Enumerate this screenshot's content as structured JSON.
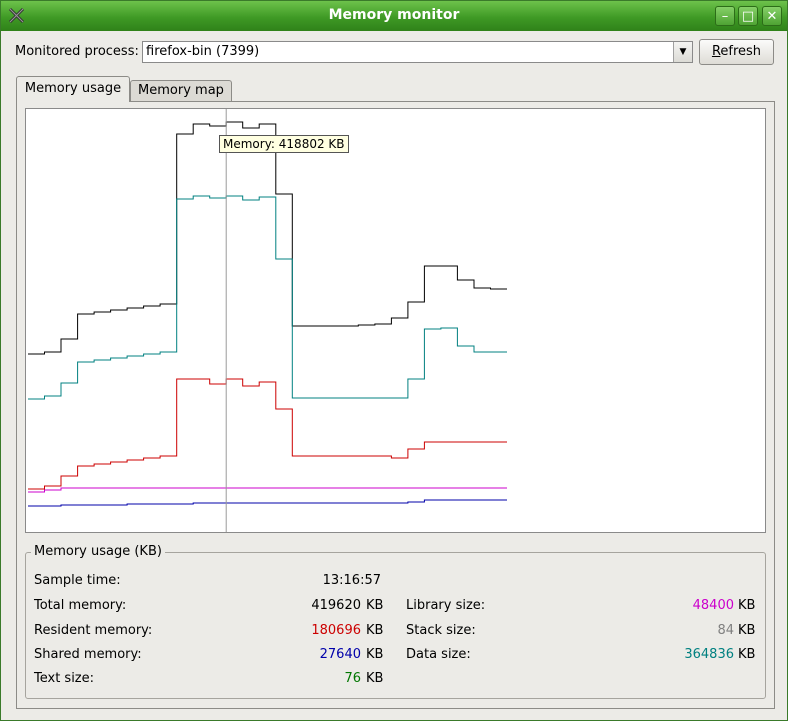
{
  "window": {
    "title": "Memory monitor"
  },
  "toolbar": {
    "process_label": "Monitored process:",
    "process_value": "firefox-bin (7399)",
    "refresh_prefix": "R",
    "refresh_rest": "efresh"
  },
  "tabs": [
    {
      "label": "Memory usage",
      "active": true
    },
    {
      "label": "Memory map",
      "active": false
    }
  ],
  "tooltip": {
    "text": "Memory: 418802 KB"
  },
  "colors": {
    "total": "#000000",
    "resident": "#cc0000",
    "shared": "#0000aa",
    "text": "#007700",
    "library": "#cc00cc",
    "stack": "#808080",
    "data": "#008080"
  },
  "chart_data": {
    "type": "line",
    "series": [
      {
        "key": "total",
        "values": [
          170,
          172,
          185,
          210,
          212,
          214,
          216,
          218,
          220,
          390,
          400,
          398,
          402,
          396,
          400,
          330,
          198,
          198,
          198,
          198,
          199,
          200,
          206,
          222,
          258,
          258,
          244,
          236,
          235,
          235
        ]
      },
      {
        "key": "data",
        "values": [
          125,
          128,
          141,
          162,
          164,
          166,
          168,
          170,
          172,
          325,
          328,
          326,
          328,
          324,
          327,
          265,
          126,
          126,
          126,
          126,
          126,
          126,
          126,
          145,
          195,
          196,
          178,
          172,
          172,
          172
        ]
      },
      {
        "key": "resident",
        "values": [
          35,
          38,
          48,
          58,
          60,
          62,
          64,
          66,
          68,
          145,
          145,
          140,
          145,
          138,
          142,
          115,
          68,
          68,
          68,
          68,
          68,
          68,
          66,
          75,
          82,
          82,
          82,
          82,
          82,
          82
        ]
      },
      {
        "key": "library",
        "values": [
          32,
          34,
          36,
          36,
          36,
          36,
          36,
          36,
          36,
          36,
          36,
          36,
          36,
          36,
          36,
          36,
          36,
          36,
          36,
          36,
          36,
          36,
          36,
          36,
          36,
          36,
          36,
          36,
          36,
          36
        ]
      },
      {
        "key": "shared",
        "values": [
          18,
          18,
          19,
          19,
          19,
          19,
          20,
          20,
          20,
          20,
          21,
          21,
          21,
          21,
          21,
          21,
          21,
          21,
          21,
          21,
          21,
          21,
          21,
          22,
          24,
          24,
          24,
          24,
          24,
          24
        ]
      }
    ],
    "cursor_index": 12
  },
  "stats": {
    "legend": "Memory usage (KB)",
    "sample_time_label": "Sample time:",
    "sample_time": "13:16:57",
    "unit": "KB",
    "left": [
      {
        "label": "Total memory:",
        "value": "419620",
        "color": "#000000"
      },
      {
        "label": "Resident memory:",
        "value": "180696",
        "color": "#cc0000"
      },
      {
        "label": "Shared memory:",
        "value": "27640",
        "color": "#0000aa"
      },
      {
        "label": "Text size:",
        "value": "76",
        "color": "#007700"
      }
    ],
    "right": [
      {
        "label": "Library size:",
        "value": "48400",
        "color": "#cc00cc"
      },
      {
        "label": "Stack size:",
        "value": "84",
        "color": "#808080"
      },
      {
        "label": "Data size:",
        "value": "364836",
        "color": "#008080"
      }
    ]
  }
}
